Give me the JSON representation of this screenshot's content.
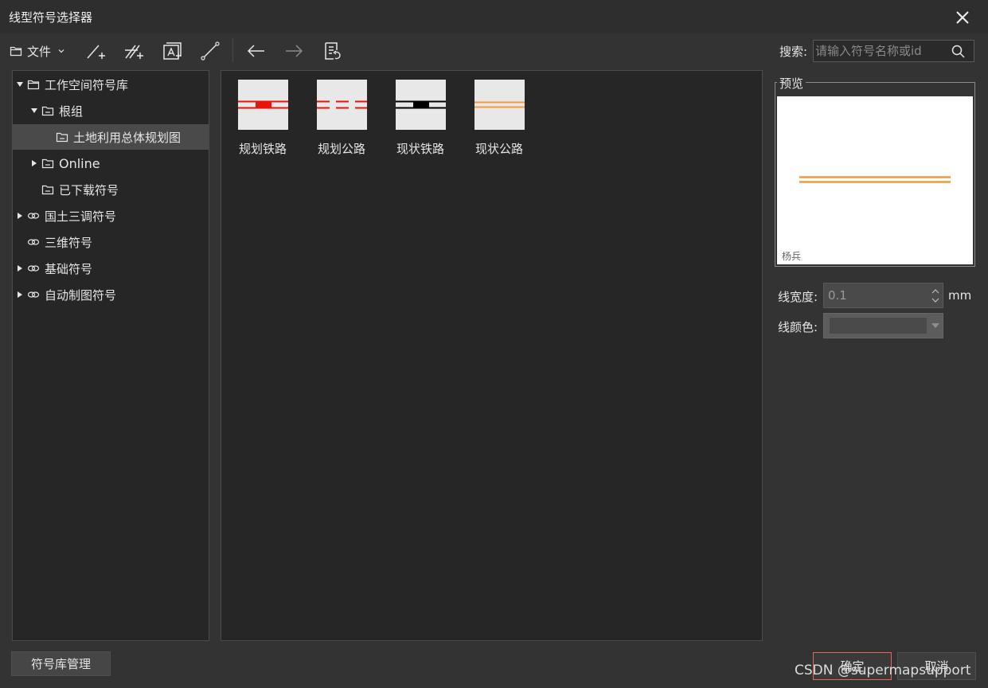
{
  "window": {
    "title": "线型符号选择器",
    "close_icon": "close-icon"
  },
  "toolbar": {
    "file_label": "文件",
    "search_label": "搜索:",
    "search_placeholder": "请输入符号名称或id"
  },
  "tree": {
    "items": [
      {
        "label": "工作空间符号库",
        "icon": "folder-icon",
        "expanded": true
      },
      {
        "label": "根组",
        "icon": "folder-icon",
        "expanded": true
      },
      {
        "label": "土地利用总体规划图",
        "icon": "folder-icon",
        "selected": true
      },
      {
        "label": "Online",
        "icon": "folder-icon",
        "expanded": false
      },
      {
        "label": "已下载符号",
        "icon": "folder-icon"
      },
      {
        "label": "国土三调符号",
        "icon": "link-icon",
        "expanded": false
      },
      {
        "label": "三维符号",
        "icon": "link-icon"
      },
      {
        "label": "基础符号",
        "icon": "link-icon",
        "expanded": false
      },
      {
        "label": "自动制图符号",
        "icon": "link-icon",
        "expanded": false
      }
    ]
  },
  "symbols": [
    {
      "label": "规划铁路",
      "color": "#e8150d",
      "style": "rail"
    },
    {
      "label": "规划公路",
      "color": "#e8150d",
      "style": "dashed"
    },
    {
      "label": "现状铁路",
      "color": "#000000",
      "style": "rail"
    },
    {
      "label": "现状公路",
      "color": "#f29a3c",
      "style": "double"
    }
  ],
  "preview": {
    "title": "预览",
    "watermark": "杨兵",
    "line_color": "#f29a3c"
  },
  "properties": {
    "width_label": "线宽度:",
    "width_value": "0.1",
    "width_unit": "mm",
    "color_label": "线颜色:",
    "color_value": "#4a4a4a"
  },
  "buttons": {
    "manage": "符号库管理",
    "ok": "确定",
    "cancel": "取消"
  },
  "watermark_text": "CSDN @supermapsupport"
}
